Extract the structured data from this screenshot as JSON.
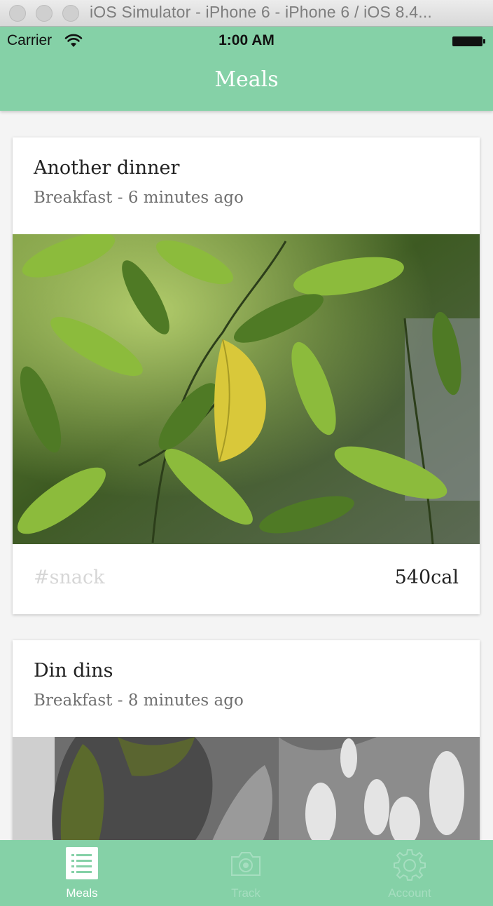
{
  "window": {
    "title": "iOS Simulator - iPhone 6 - iPhone 6 / iOS 8.4..."
  },
  "status_bar": {
    "carrier": "Carrier",
    "time": "1:00 AM"
  },
  "nav": {
    "title": "Meals"
  },
  "meals": [
    {
      "title": "Another dinner",
      "subtitle": "Breakfast - 6 minutes ago",
      "tag": "#snack",
      "calories": "540cal"
    },
    {
      "title": "Din dins",
      "subtitle": "Breakfast - 8 minutes ago"
    }
  ],
  "tabs": [
    {
      "label": "Meals",
      "icon": "list-icon",
      "active": true
    },
    {
      "label": "Track",
      "icon": "camera-icon",
      "active": false
    },
    {
      "label": "Account",
      "icon": "gear-icon",
      "active": false
    }
  ],
  "colors": {
    "brand": "#85d1a7",
    "tab_inactive": "#a6dec0",
    "tag": "#d6d6d6"
  }
}
